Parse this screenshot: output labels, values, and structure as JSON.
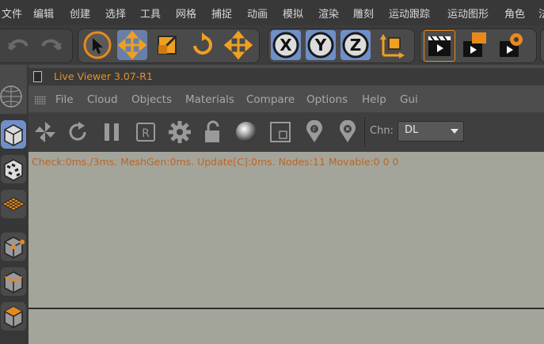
{
  "top_menu": [
    "文件",
    "编辑",
    "创建",
    "选择",
    "工具",
    "网格",
    "捕捉",
    "动画",
    "模拟",
    "渲染",
    "雕刻",
    "运动跟踪",
    "运动图形",
    "角色",
    "法"
  ],
  "toolbar_icons": [
    "undo-icon",
    "redo-icon",
    "select-arrow-icon",
    "move-icon",
    "scale-icon",
    "rotate-icon",
    "move-icon",
    "x-axis-lock-icon",
    "y-axis-lock-icon",
    "z-axis-lock-icon",
    "coordinate-system-icon",
    "render-view-icon",
    "render-picture-icon",
    "render-settings-icon"
  ],
  "axis_labels": {
    "x": "X",
    "y": "Y",
    "z": "Z"
  },
  "window": {
    "title": "Live Viewer 3.07-R1",
    "menu": [
      "File",
      "Cloud",
      "Objects",
      "Materials",
      "Compare",
      "Options",
      "Help",
      "Gui"
    ]
  },
  "viewer_toolbar": {
    "chn_label": "Chn:",
    "chn_value": "DL"
  },
  "status_line": "Check:0ms./3ms. MeshGen:0ms. Update[C]:0ms. Nodes:11 Movable:0  0 0",
  "colors": {
    "accent_orange": "#e8891d",
    "status_text": "#b8662a",
    "title_text": "#e28f2a",
    "canvas_bg": "#a4a59a",
    "axis_blue": "#6f8fc9"
  }
}
